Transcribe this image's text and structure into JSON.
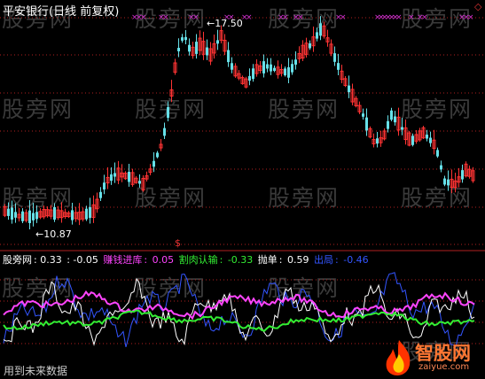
{
  "title": "平安银行(日线 前复权)",
  "watermark": "股旁网",
  "price_labels": {
    "high": "17.50",
    "low": "10.87"
  },
  "indicator": {
    "name": "股旁网",
    "v1": ": 0.33",
    "v2": ": -0.05",
    "earn_label": "赚钱进库",
    "earn_value": "0.05",
    "cut_label": "割肉认输",
    "cut_value": "-0.33",
    "sell_label": "抛单",
    "sell_value": "0.59",
    "exit_label": "出局",
    "exit_value": "-0.46"
  },
  "footer_text": "用到未来数据",
  "logo": {
    "text": "智股网",
    "url": "zaiyue.com"
  },
  "signal_marker": "$",
  "colors": {
    "up_candle": "#ff3333",
    "down_candle": "#66e0e8",
    "earn": "#ff44ff",
    "cut": "#33ee33",
    "sell": "#ffffff",
    "exit": "#3355ff",
    "grid": "#b02020",
    "marker_top": "#d030d0"
  },
  "icons": {
    "diamond": "diamond-icon",
    "logo": "flame-icon"
  }
}
